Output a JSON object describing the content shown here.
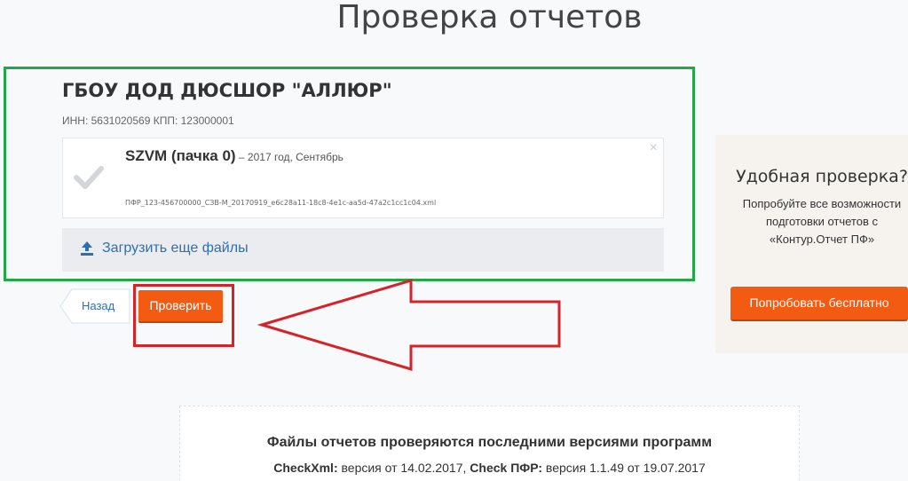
{
  "page": {
    "title": "Проверка отчетов"
  },
  "org": {
    "name": "ГБОУ ДОД ДЮСШОР \"АЛЛЮР\"",
    "ids": "ИНН: 5631020569 КПП: 123000001"
  },
  "file": {
    "type": "SZVM (пачка 0)",
    "period": " – 2017 год, Сентябрь",
    "filename": "ПФР_123-456700000_СЗВ-М_20170919_e6c28a11-18c8-4e1c-aa5d-47a2c1cc1c04.xml",
    "close_glyph": "×"
  },
  "upload": {
    "label": "Загрузить еще файлы"
  },
  "actions": {
    "back_label": "Назад",
    "check_label": "Проверить"
  },
  "promo": {
    "title": "Удобная проверка?",
    "text": "Попробуйте все возможности подготовки отчетов с «Контур.Отчет ПФ»",
    "button": "Попробовать бесплатно"
  },
  "info": {
    "title": "Файлы отчетов проверяются последними версиями программ",
    "checkxml_name": "CheckXml:",
    "checkxml_version": " версия от 14.02.2017, ",
    "checkpfr_name": "Check ПФР:",
    "checkpfr_version": " версия 1.1.49 от 19.07.2017"
  },
  "colors": {
    "highlight_green": "#22a846",
    "highlight_red": "#d4232a",
    "accent_orange": "#f35b12",
    "link_blue": "#2d6fb3"
  },
  "icons": [
    "check-icon",
    "close-icon",
    "upload-icon",
    "arrow-icon"
  ]
}
